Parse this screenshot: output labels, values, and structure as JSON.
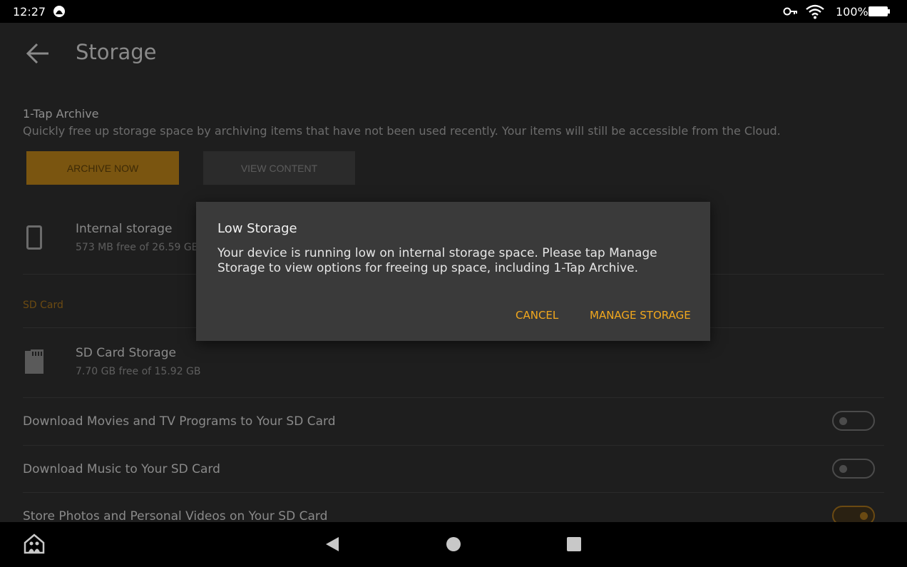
{
  "status_bar": {
    "time": "12:27",
    "battery_text": "100%",
    "icons": [
      "notification-icon",
      "vpn-key-icon",
      "wifi-icon",
      "battery-icon"
    ]
  },
  "header": {
    "title": "Storage",
    "back_icon": "back-arrow-icon"
  },
  "archive": {
    "title": "1-Tap Archive",
    "description": "Quickly free up storage space by archiving items that have not been used recently. Your items will still be accessible from the Cloud.",
    "archive_now_label": "ARCHIVE NOW",
    "view_content_label": "VIEW CONTENT"
  },
  "internal_storage": {
    "title": "Internal storage",
    "subtitle": "573 MB free of 26.59 GB"
  },
  "sd_card": {
    "section_label": "SD Card",
    "title": "SD Card Storage",
    "subtitle": "7.70 GB free of 15.92 GB"
  },
  "settings": [
    {
      "label": "Download Movies and TV Programs to Your SD Card",
      "enabled": false
    },
    {
      "label": "Download Music to Your SD Card",
      "enabled": false
    },
    {
      "label": "Store Photos and Personal Videos on Your SD Card",
      "enabled": true
    }
  ],
  "dialog": {
    "title": "Low Storage",
    "message": "Your device is running low on internal storage space. Please tap Manage Storage to view options for freeing up space, including 1-Tap Archive.",
    "cancel_label": "CANCEL",
    "manage_label": "MANAGE STORAGE"
  },
  "colors": {
    "accent": "#f2a81d",
    "dialog_bg": "#3a3a3a",
    "background": "#1b1b1b"
  }
}
